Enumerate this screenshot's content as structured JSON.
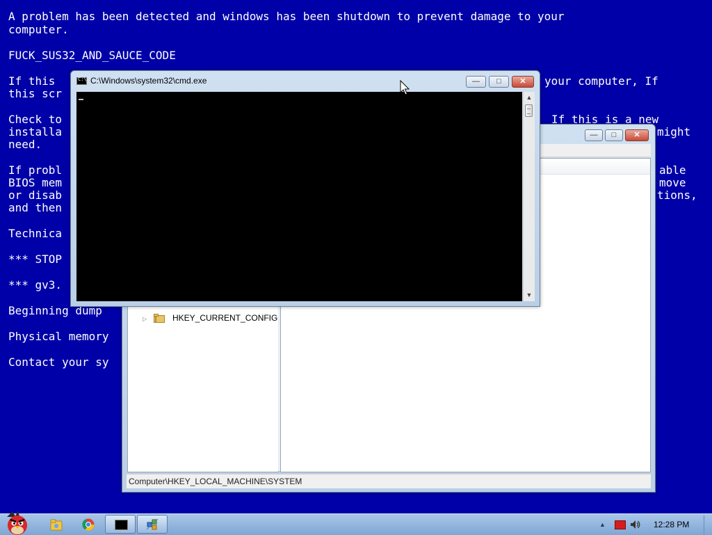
{
  "bsod": {
    "lines": [
      "A problem has been detected and windows has been shutdown to prevent damage to your",
      "computer.",
      "",
      "FUCK_SUS32_AND_SAUCE_CODE",
      "",
      "If this",
      "this scr",
      "",
      "Check to",
      "installa",
      "need.",
      "",
      "If probl",
      "BIOS mem",
      "or disab",
      "and then",
      "",
      "Technica",
      "",
      "*** STOP",
      "",
      "*** gv3.",
      "",
      "Beginning dump",
      "",
      "Physical memory",
      "",
      "Contact your sy"
    ],
    "right_fragments": {
      "r1": "your computer, If",
      "r2": "If this is a new",
      "r3": "might",
      "r4": "able",
      "r5": "move",
      "r6": "tions,"
    }
  },
  "cmd_window": {
    "title": "C:\\Windows\\system32\\cmd.exe",
    "minimize_label": "—",
    "maximize_label": "□",
    "close_label": "✕",
    "scroll_up": "▲",
    "scroll_down": "▼"
  },
  "regedit_window": {
    "minimize_label": "—",
    "maximize_label": "□",
    "close_label": "✕",
    "tree_item": "HKEY_CURRENT_CONFIG",
    "tree_expander": "▷",
    "status_path": "Computer\\HKEY_LOCAL_MACHINE\\SYSTEM"
  },
  "taskbar": {
    "clock": "12:28 PM",
    "tray_arrow": "▲",
    "icons": [
      "angry-bird-start-icon",
      "explorer-icon",
      "chrome-icon",
      "cmd-icon",
      "regedit-icon"
    ]
  }
}
